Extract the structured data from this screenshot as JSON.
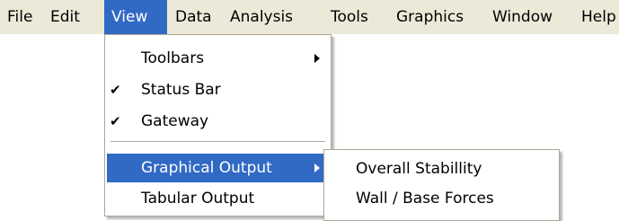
{
  "menubar": {
    "items": [
      {
        "label": "File"
      },
      {
        "label": "Edit"
      },
      {
        "label": "View"
      },
      {
        "label": "Data"
      },
      {
        "label": "Analysis"
      },
      {
        "label": "Tools"
      },
      {
        "label": "Graphics"
      },
      {
        "label": "Window"
      },
      {
        "label": "Help"
      }
    ]
  },
  "view_menu": {
    "items": [
      {
        "label": "Toolbars",
        "has_submenu": true
      },
      {
        "label": "Status Bar",
        "checked": true
      },
      {
        "label": "Gateway",
        "checked": true
      },
      {
        "label": "Graphical Output",
        "has_submenu": true,
        "highlighted": true
      },
      {
        "label": "Tabular Output"
      }
    ],
    "check_glyph": "✔"
  },
  "graphical_output_submenu": {
    "items": [
      {
        "label": "Overall Stabillity"
      },
      {
        "label": "Wall / Base Forces"
      }
    ]
  },
  "colors": {
    "menubar_bg": "#ece9d8",
    "highlight": "#316ac5",
    "highlight_text": "#ffffff",
    "menu_border": "#aca899"
  }
}
